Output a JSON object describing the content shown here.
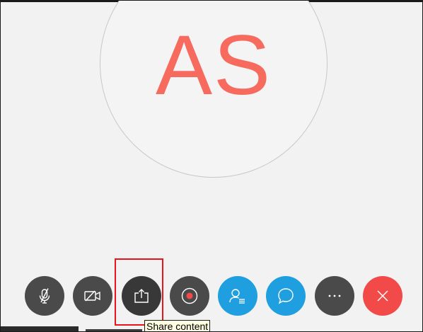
{
  "participant": {
    "initials": "AS",
    "initials_color": "#f76a5e"
  },
  "controls": [
    {
      "id": "mute",
      "icon": "mic-off-icon",
      "style": "dark"
    },
    {
      "id": "video",
      "icon": "video-off-icon",
      "style": "dark"
    },
    {
      "id": "share",
      "icon": "share-content-icon",
      "style": "dark",
      "highlighted": true
    },
    {
      "id": "record",
      "icon": "record-icon",
      "style": "dark"
    },
    {
      "id": "participants",
      "icon": "participants-icon",
      "style": "blue"
    },
    {
      "id": "chat",
      "icon": "chat-icon",
      "style": "blue"
    },
    {
      "id": "more",
      "icon": "more-options-icon",
      "style": "dark"
    },
    {
      "id": "leave",
      "icon": "close-icon",
      "style": "red"
    }
  ],
  "tooltip": {
    "text": "Share content"
  },
  "colors": {
    "background": "#f2f2f2",
    "control_dark": "#4a4a4a",
    "control_blue": "#1f9fe0",
    "control_red": "#f14a48",
    "record_dot": "#f14a48",
    "highlight": "#e8141b"
  }
}
